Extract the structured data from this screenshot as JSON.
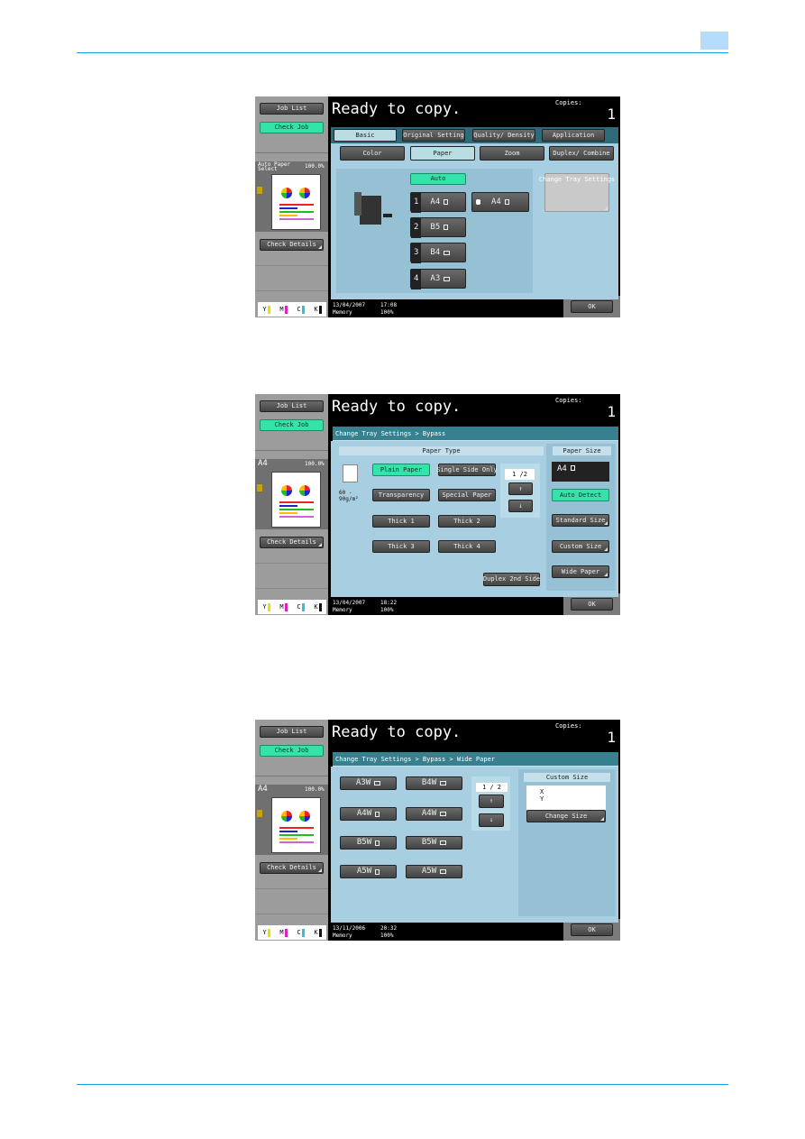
{
  "common": {
    "job_list": "Job List",
    "check_job": "Check Job",
    "check_details": "Check Details",
    "ready": "Ready to copy.",
    "copies_label": "Copies:",
    "copies": "1",
    "ok": "OK",
    "memory_label": "Memory",
    "memory": "100%",
    "toner": [
      {
        "label": "Y",
        "color": "#e8e000"
      },
      {
        "label": "M",
        "color": "#e020c0"
      },
      {
        "label": "C",
        "color": "#30c0e0"
      },
      {
        "label": "K",
        "color": "#111111"
      }
    ],
    "accent_green": "#33e3aa",
    "rule_color": "#1a9ad6"
  },
  "screens": [
    {
      "preview_label": "Auto Paper Select",
      "preview_zoom": "100.0%",
      "date": "13/04/2007",
      "time": "17:08",
      "tabs": [
        "Basic",
        "Original Setting",
        "Quality/ Density",
        "Application"
      ],
      "subtabs": [
        "Color",
        "Paper",
        "Zoom",
        "Duplex/ Combine"
      ],
      "auto": "Auto",
      "trays": [
        {
          "num": "1",
          "size": "A4",
          "icon": "paper-portrait-icon"
        },
        {
          "num": "2",
          "size": "B5",
          "icon": "paper-portrait-icon"
        },
        {
          "num": "3",
          "size": "B4",
          "icon": "paper-landscape-icon"
        },
        {
          "num": "4",
          "size": "A3",
          "icon": "paper-landscape-icon"
        }
      ],
      "bypass": {
        "size": "A4",
        "icon": "hand-icon"
      },
      "change_tray": "Change Tray Settings"
    },
    {
      "preview_label": "A4",
      "preview_zoom": "100.0%",
      "date": "13/04/2007",
      "time": "18:22",
      "breadcrumb": "Change Tray Settings > Bypass",
      "paper_type_header": "Paper Type",
      "paper_size_header": "Paper Size",
      "weight": "60 - 90g/m²",
      "types": [
        "Plain Paper",
        "Single Side Only",
        "Transparency",
        "Special Paper",
        "Thick 1",
        "Thick 2",
        "Thick 3",
        "Thick 4"
      ],
      "selected_type": "Plain Paper",
      "page": "1 /2",
      "duplex": "Duplex 2nd Side",
      "size_display": "A4",
      "size_buttons": [
        "Auto Detect",
        "Standard Size",
        "Custom Size",
        "Wide Paper"
      ]
    },
    {
      "preview_label": "A4",
      "preview_zoom": "100.0%",
      "date": "13/11/2006",
      "time": "20:32",
      "breadcrumb": "Change Tray Settings > Bypass > Wide Paper",
      "wide": [
        "A3W",
        "B4W",
        "A4W",
        "A4W",
        "B5W",
        "B5W",
        "A5W",
        "A5W"
      ],
      "page": "1 / 2",
      "custom_size_header": "Custom Size",
      "x_label": "X",
      "y_label": "Y",
      "change_size": "Change Size"
    }
  ]
}
